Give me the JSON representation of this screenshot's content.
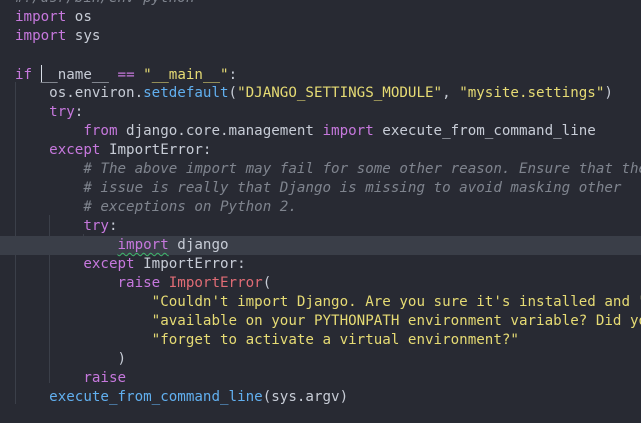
{
  "editor": {
    "lines": [
      {
        "tokens": [
          {
            "t": "cm",
            "v": "#!/usr/bin/env python"
          }
        ]
      },
      {
        "tokens": [
          {
            "t": "kw",
            "v": "import"
          },
          {
            "t": "pl",
            "v": " os"
          }
        ]
      },
      {
        "tokens": [
          {
            "t": "kw",
            "v": "import"
          },
          {
            "t": "pl",
            "v": " sys"
          }
        ]
      },
      {
        "tokens": []
      },
      {
        "tokens": [
          {
            "t": "kw",
            "v": "if"
          },
          {
            "t": "pl",
            "v": " "
          },
          {
            "t": "cursor",
            "v": ""
          },
          {
            "t": "pl",
            "v": "__name__"
          },
          {
            "t": "pl",
            "v": " "
          },
          {
            "t": "op",
            "v": "=="
          },
          {
            "t": "pl",
            "v": " "
          },
          {
            "t": "str",
            "v": "\"__main__\""
          },
          {
            "t": "pl",
            "v": ":"
          }
        ]
      },
      {
        "tokens": [
          {
            "t": "pl",
            "v": "    os.environ."
          },
          {
            "t": "fn",
            "v": "setdefault"
          },
          {
            "t": "pl",
            "v": "("
          },
          {
            "t": "str",
            "v": "\"DJANGO_SETTINGS_MODULE\""
          },
          {
            "t": "pl",
            "v": ", "
          },
          {
            "t": "str",
            "v": "\"mysite.settings\""
          },
          {
            "t": "pl",
            "v": ")"
          }
        ]
      },
      {
        "tokens": [
          {
            "t": "pl",
            "v": "    "
          },
          {
            "t": "kw",
            "v": "try"
          },
          {
            "t": "pl",
            "v": ":"
          }
        ]
      },
      {
        "tokens": [
          {
            "t": "pl",
            "v": "        "
          },
          {
            "t": "kw",
            "v": "from"
          },
          {
            "t": "pl",
            "v": " django.core.management "
          },
          {
            "t": "kw",
            "v": "import"
          },
          {
            "t": "pl",
            "v": " execute_from_command_line"
          }
        ]
      },
      {
        "tokens": [
          {
            "t": "pl",
            "v": "    "
          },
          {
            "t": "kw",
            "v": "except"
          },
          {
            "t": "pl",
            "v": " ImportError:"
          }
        ]
      },
      {
        "tokens": [
          {
            "t": "pl",
            "v": "        "
          },
          {
            "t": "cm",
            "v": "# The above import may fail for some other reason. Ensure that the"
          }
        ]
      },
      {
        "tokens": [
          {
            "t": "pl",
            "v": "        "
          },
          {
            "t": "cm",
            "v": "# issue is really that Django is missing to avoid masking other"
          }
        ]
      },
      {
        "tokens": [
          {
            "t": "pl",
            "v": "        "
          },
          {
            "t": "cm",
            "v": "# exceptions on Python 2."
          }
        ]
      },
      {
        "tokens": [
          {
            "t": "pl",
            "v": "        "
          },
          {
            "t": "kw",
            "v": "try"
          },
          {
            "t": "pl",
            "v": ":"
          }
        ]
      },
      {
        "current": true,
        "tokens": [
          {
            "t": "pl",
            "v": "            "
          },
          {
            "t": "kw squig",
            "v": "import"
          },
          {
            "t": "pl",
            "v": " django"
          }
        ]
      },
      {
        "tokens": [
          {
            "t": "pl",
            "v": "        "
          },
          {
            "t": "kw",
            "v": "except"
          },
          {
            "t": "pl",
            "v": " ImportError:"
          }
        ]
      },
      {
        "tokens": [
          {
            "t": "pl",
            "v": "            "
          },
          {
            "t": "kw",
            "v": "raise"
          },
          {
            "t": "pl",
            "v": " "
          },
          {
            "t": "cls",
            "v": "ImportError"
          },
          {
            "t": "pl",
            "v": "("
          }
        ]
      },
      {
        "tokens": [
          {
            "t": "pl",
            "v": "                "
          },
          {
            "t": "str",
            "v": "\"Couldn't import Django. Are you sure it's installed and \""
          }
        ]
      },
      {
        "tokens": [
          {
            "t": "pl",
            "v": "                "
          },
          {
            "t": "str",
            "v": "\"available on your PYTHONPATH environment variable? Did you \""
          }
        ]
      },
      {
        "tokens": [
          {
            "t": "pl",
            "v": "                "
          },
          {
            "t": "str",
            "v": "\"forget to activate a virtual environment?\""
          }
        ]
      },
      {
        "tokens": [
          {
            "t": "pl",
            "v": "            )"
          }
        ]
      },
      {
        "tokens": [
          {
            "t": "pl",
            "v": "        "
          },
          {
            "t": "kw",
            "v": "raise"
          }
        ]
      },
      {
        "tokens": [
          {
            "t": "pl",
            "v": "    "
          },
          {
            "t": "fn",
            "v": "execute_from_command_line"
          },
          {
            "t": "pl",
            "v": "(sys.argv)"
          }
        ]
      }
    ]
  },
  "colors": {
    "background": "#282a33",
    "current_line": "#3a3e48",
    "keyword": "#c678dd",
    "function": "#61afef",
    "string": "#e6db74",
    "class": "#e06c75",
    "comment": "#7f848e",
    "plain": "#c7ccd6"
  }
}
